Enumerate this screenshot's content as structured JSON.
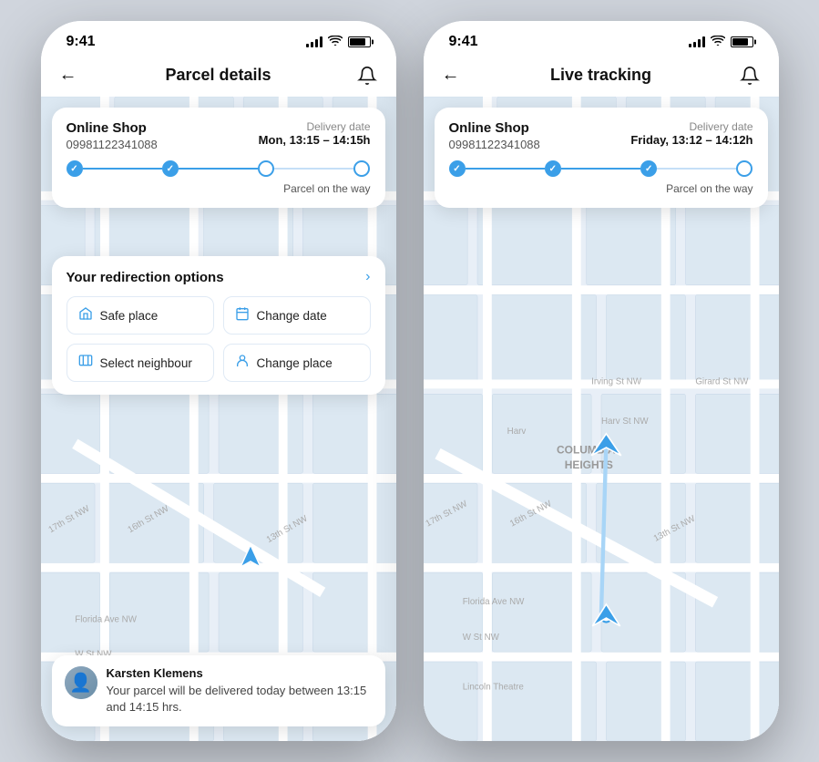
{
  "phone1": {
    "status_bar": {
      "time": "9:41"
    },
    "header": {
      "back_label": "←",
      "title": "Parcel details",
      "bell_label": "🔔"
    },
    "card": {
      "shop_name": "Online Shop",
      "phone": "09981122341088",
      "delivery_label": "Delivery date",
      "delivery_time": "Mon, 13:15 – 14:15h",
      "status": "Parcel on the way",
      "progress": [
        {
          "filled": true
        },
        {
          "filled": true
        },
        {
          "filled": false
        },
        {
          "filled": false
        }
      ]
    },
    "redirection": {
      "title": "Your redirection options",
      "arrow": "›",
      "options": [
        {
          "icon": "🏠",
          "label": "Safe place"
        },
        {
          "icon": "📅",
          "label": "Change date"
        },
        {
          "icon": "📦",
          "label": "Select neighbour"
        },
        {
          "icon": "👤",
          "label": "Change place"
        }
      ]
    },
    "notification": {
      "name": "Karsten Klemens",
      "body": "Your parcel will be delivered today between 13:15 and 14:15 hrs."
    }
  },
  "phone2": {
    "status_bar": {
      "time": "9:41"
    },
    "header": {
      "back_label": "←",
      "title": "Live tracking",
      "bell_label": "🔔"
    },
    "card": {
      "shop_name": "Online Shop",
      "phone": "09981122341088",
      "delivery_label": "Delivery date",
      "delivery_time": "Friday, 13:12 – 14:12h",
      "status": "Parcel on the way",
      "progress": [
        {
          "filled": true
        },
        {
          "filled": true
        },
        {
          "filled": true
        },
        {
          "filled": false
        }
      ]
    }
  }
}
